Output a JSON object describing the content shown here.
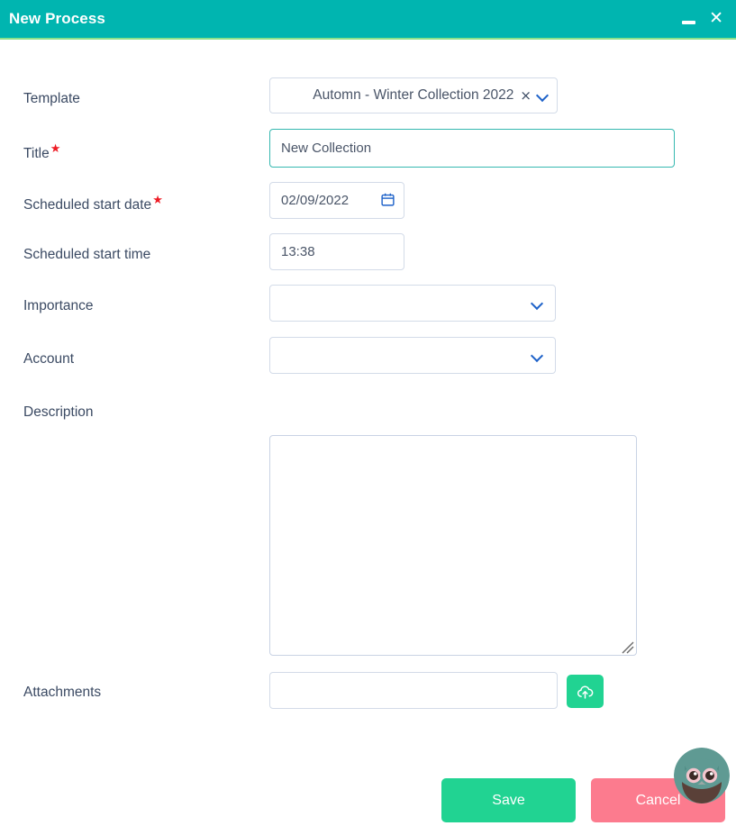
{
  "window": {
    "title": "New Process",
    "minimize_label": "—",
    "close_label": "✕",
    "titlebar_color": "#00b5b0",
    "accent_line_color": "#8ce08a"
  },
  "form": {
    "rows": [
      {
        "label": "Template",
        "required": false,
        "type": "select-token",
        "value": "Automn - Winter Collection 2022",
        "clear_label": "×"
      },
      {
        "label": "Title",
        "required": true,
        "type": "text",
        "value": "New Collection",
        "focused": true
      },
      {
        "label": "Scheduled start date",
        "required": true,
        "type": "date",
        "value": "02/09/2022",
        "icon": "calendar-icon"
      },
      {
        "label": "Scheduled start time",
        "required": false,
        "type": "time",
        "value": "13:38"
      },
      {
        "label": "Importance",
        "required": false,
        "type": "select",
        "value": ""
      },
      {
        "label": "Account",
        "required": false,
        "type": "select",
        "value": ""
      },
      {
        "label": "Description",
        "required": false,
        "type": "textarea",
        "value": "",
        "placeholder": ""
      },
      {
        "label": "Attachments",
        "required": false,
        "type": "file",
        "value": "",
        "placeholder": ""
      }
    ],
    "required_marker": "★"
  },
  "footer": {
    "save_label": "Save",
    "cancel_label": "Cancel",
    "save_color": "#21d392",
    "cancel_color": "#fc7b8e"
  },
  "upload": {
    "icon": "cloud-upload-icon",
    "button_color": "#21d392"
  },
  "avatar": {
    "name": "owl-mascot-avatar"
  }
}
